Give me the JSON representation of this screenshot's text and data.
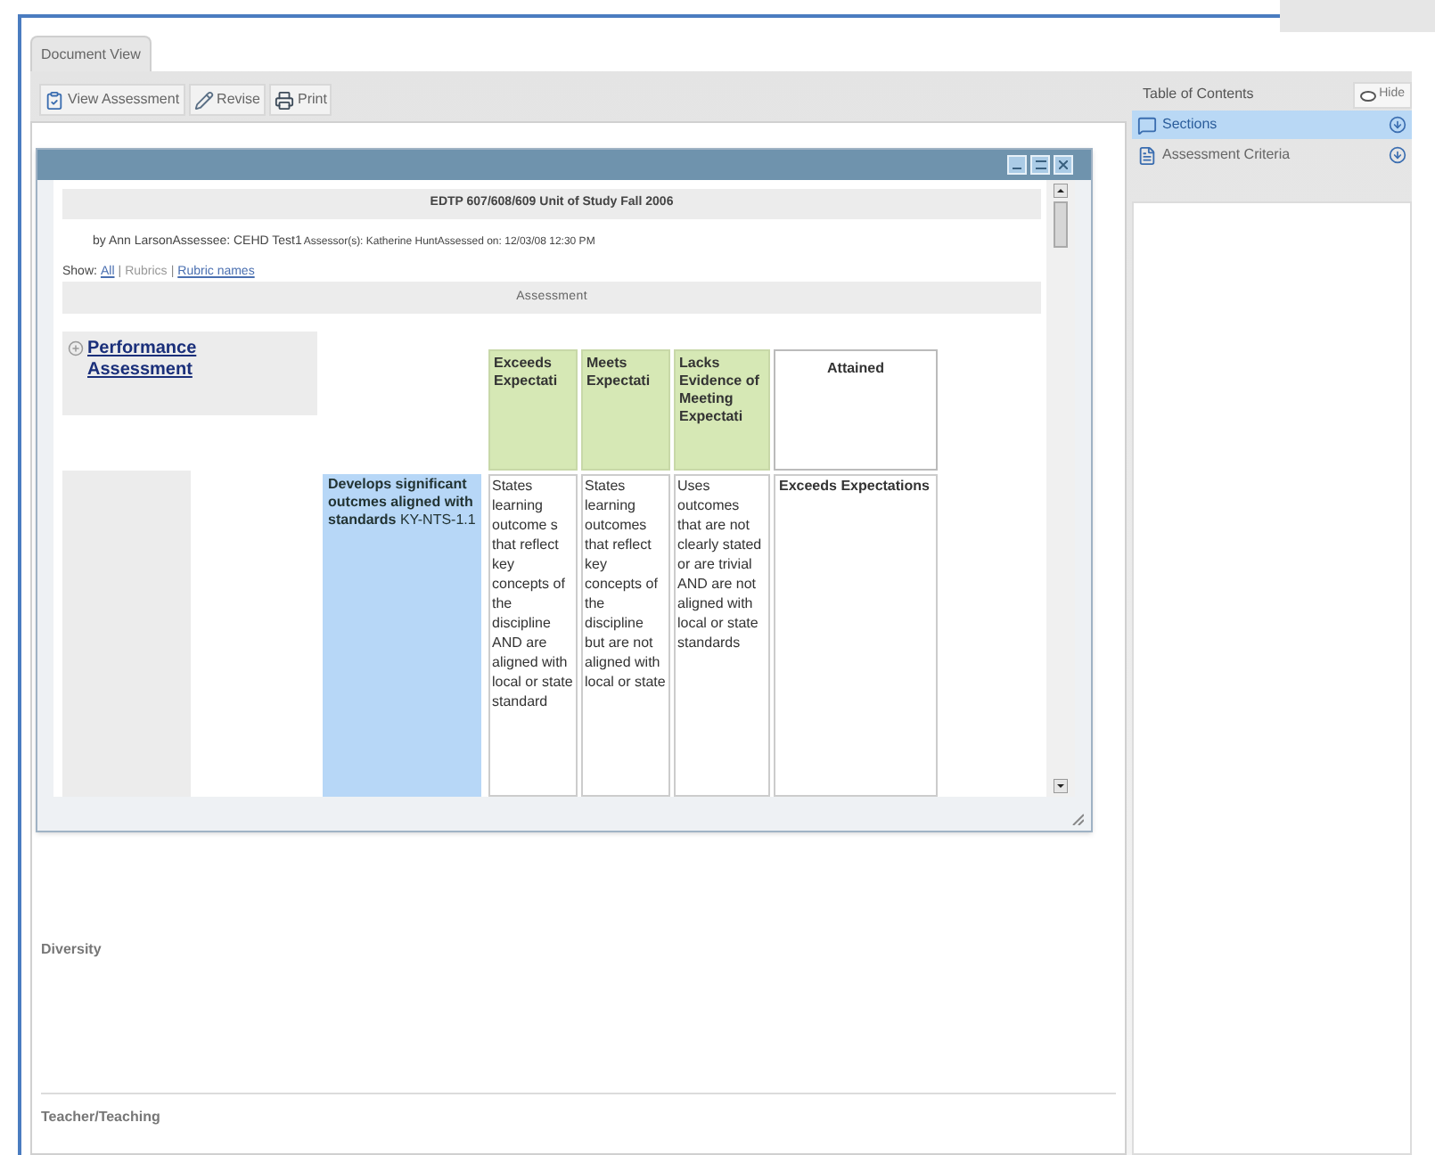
{
  "tab": {
    "label": "Document View",
    "selected": true
  },
  "toolbar": [
    {
      "kind": "view",
      "label": "View Assessment"
    },
    {
      "kind": "revise",
      "label": "Revise"
    },
    {
      "kind": "print",
      "label": "Print"
    }
  ],
  "header": {
    "title": "EDTP 607/608/609 Unit of Study Fall 2006",
    "byline": "by Ann LarsonAssessee: CEHD Test1",
    "assessor": "Assessor(s): Katherine HuntAssessed on: 12/03/08 12:30 PM"
  },
  "show": {
    "label": "Show:",
    "options": [
      {
        "kind": "option",
        "label": "All",
        "selected": false
      },
      {
        "kind": "separator",
        "label": "|"
      },
      {
        "kind": "option",
        "label": "Rubrics",
        "selected": true
      },
      {
        "kind": "separator",
        "label": "|"
      },
      {
        "kind": "option",
        "label": "Rubric names",
        "selected": false
      }
    ]
  },
  "section_heading": "Assessment",
  "rubric": {
    "title": "Performance Assessment",
    "expanded": false,
    "columns": [
      {
        "kind": "level",
        "label": "Exceeds Expectati"
      },
      {
        "kind": "level",
        "label": "Meets Expectati"
      },
      {
        "kind": "level",
        "label": "Lacks Evidence of Meeting Expectati"
      },
      {
        "kind": "result",
        "label": "Attained"
      }
    ],
    "rows": [
      {
        "criterion": "**Develops significant outcmes aligned with standards** KY-NTS-1.1",
        "cells": [
          "States learning outcome s that reflect key concepts of the discipline AND are aligned with local or state standard",
          "States learning outcomes that reflect key concepts of the discipline but are not aligned with local or state",
          "Uses outcomes that are not clearly stated or are trivial AND are not aligned with local or state standards"
        ],
        "attained": "Exceeds Expectations"
      }
    ]
  },
  "document_sections": [
    "Diversity",
    "Teacher/Teaching"
  ],
  "toc": {
    "title": "Table of Contents",
    "hide_label": "Hide",
    "items": [
      {
        "kind": "sections",
        "label": "Sections",
        "selected": true
      },
      {
        "kind": "criteria",
        "label": "Assessment Criteria",
        "selected": false
      }
    ]
  }
}
